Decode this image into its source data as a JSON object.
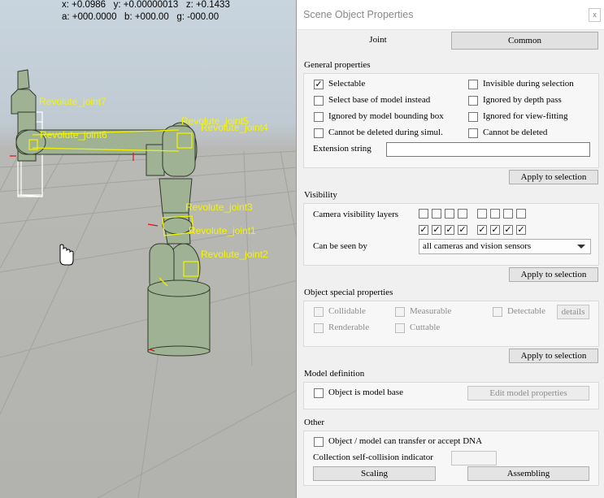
{
  "viewport": {
    "coords_line1": "x: +0.0986   y: +0.00000013   z: +0.1433",
    "coords_line2": "a: +000.0000   b: +000.00   g: -000.00",
    "joint_labels": {
      "j7": "Revolute_joint7",
      "j6": "Revolute_joint6",
      "j5": "Revolute_joint5",
      "j4": "Revolute_joint4",
      "j3": "Revolute_joint3",
      "j1": "Revolute_joint1",
      "j2": "Revolute_joint2"
    }
  },
  "dialog": {
    "title": "Scene Object Properties",
    "close": "x",
    "tabs": {
      "joint": "Joint",
      "common": "Common"
    },
    "general": {
      "title": "General properties",
      "selectable": "Selectable",
      "invisible_during_selection": "Invisible during selection",
      "select_base_of_model": "Select base of model instead",
      "ignored_by_depth_pass": "Ignored by depth pass",
      "ignored_by_model_bbox": "Ignored by model bounding  box",
      "ignored_for_view_fitting": "Ignored for view-fitting",
      "cannot_be_deleted_sim": "Cannot be deleted during simul.",
      "cannot_be_deleted": "Cannot be deleted",
      "extension_string": "Extension string",
      "extension_value": "",
      "apply": "Apply to selection"
    },
    "visibility": {
      "title": "Visibility",
      "camera_layers": "Camera visibility layers",
      "layers_row1": [
        false,
        false,
        false,
        false,
        false,
        false,
        false,
        false
      ],
      "layers_row2": [
        true,
        true,
        true,
        true,
        true,
        true,
        true,
        true
      ],
      "check_glyph": "✓",
      "can_be_seen_by": "Can be seen by",
      "can_be_seen_by_value": "all cameras and vision sensors",
      "apply": "Apply to selection"
    },
    "special": {
      "title": "Object special properties",
      "collidable": "Collidable",
      "measurable": "Measurable",
      "detectable": "Detectable",
      "details": "details",
      "renderable": "Renderable",
      "cuttable": "Cuttable",
      "apply": "Apply to selection"
    },
    "model": {
      "title": "Model definition",
      "object_is_model_base": "Object is model base",
      "edit_model_properties": "Edit model properties"
    },
    "other": {
      "title": "Other",
      "dna": "Object / model can transfer or accept DNA",
      "collection_indicator": "Collection self-collision indicator",
      "collection_value": "",
      "scaling": "Scaling",
      "assembling": "Assembling"
    }
  }
}
